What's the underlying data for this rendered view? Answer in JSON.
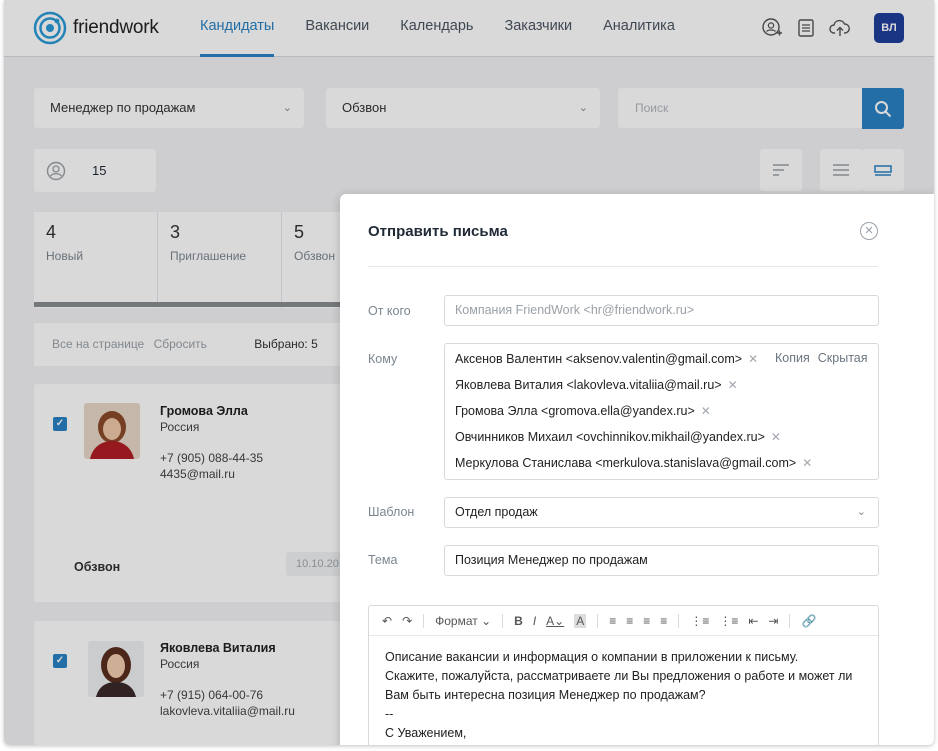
{
  "header": {
    "logo_text": "friendwork",
    "nav": [
      "Кандидаты",
      "Вакансии",
      "Календарь",
      "Заказчики",
      "Аналитика"
    ],
    "active_nav": "Кандидаты",
    "icons": [
      "add-user-icon",
      "document-icon",
      "cloud-upload-icon"
    ],
    "avatar_initials": "ВЛ"
  },
  "filters": {
    "vacancy": "Менеджер по продажам",
    "stage": "Обзвон",
    "search_placeholder": "Поиск",
    "count": "15"
  },
  "stages": [
    {
      "count": "4",
      "label": "Новый"
    },
    {
      "count": "3",
      "label": "Приглашение"
    },
    {
      "count": "5",
      "label": "Обзвон"
    }
  ],
  "selection": {
    "all_on_page": "Все на странице",
    "reset": "Сбросить",
    "selected": "Выбрано: 5"
  },
  "candidates": [
    {
      "name": "Громова Элла",
      "country": "Россия",
      "phone": "+7 (905) 088-44-35",
      "email": "4435@mail.ru",
      "stage": "Обзвон",
      "date": "10.10.20"
    },
    {
      "name": "Яковлева Виталия",
      "country": "Россия",
      "phone": "+7 (915) 064-00-76",
      "email": "lakovleva.vitaliia@mail.ru"
    }
  ],
  "modal": {
    "title": "Отправить письма",
    "from_label": "От кого",
    "from_placeholder": "Компания FriendWork <hr@friendwork.ru>",
    "to_label": "Кому",
    "recipients": [
      "Аксенов Валентин <aksenov.valentin@gmail.com>",
      "Яковлева Виталия <lakovleva.vitaliia@mail.ru>",
      "Громова Элла <gromova.ella@yandex.ru>",
      "Овчинников Михаил <ovchinnikov.mikhail@yandex.ru>",
      "Меркулова Станислава <merkulova.stanislava@gmail.com>"
    ],
    "copy": "Копия",
    "hidden": "Скрытая",
    "template_label": "Шаблон",
    "template_value": "Отдел продаж",
    "subject_label": "Тема",
    "subject_value": "Позиция Менеджер по продажам",
    "toolbar_format": "Формат",
    "body": [
      "Описание вакансии и информация о компании в приложении к письму.",
      "Скажите, пожалуйста, рассматриваете ли Вы предложения о работе и может ли",
      "Вам быть интересна позиция Менеджер по продажам?",
      "--",
      "С Уважением,"
    ]
  },
  "colors": {
    "accent": "#2a82c4",
    "avatar": "#1f3f9a"
  }
}
